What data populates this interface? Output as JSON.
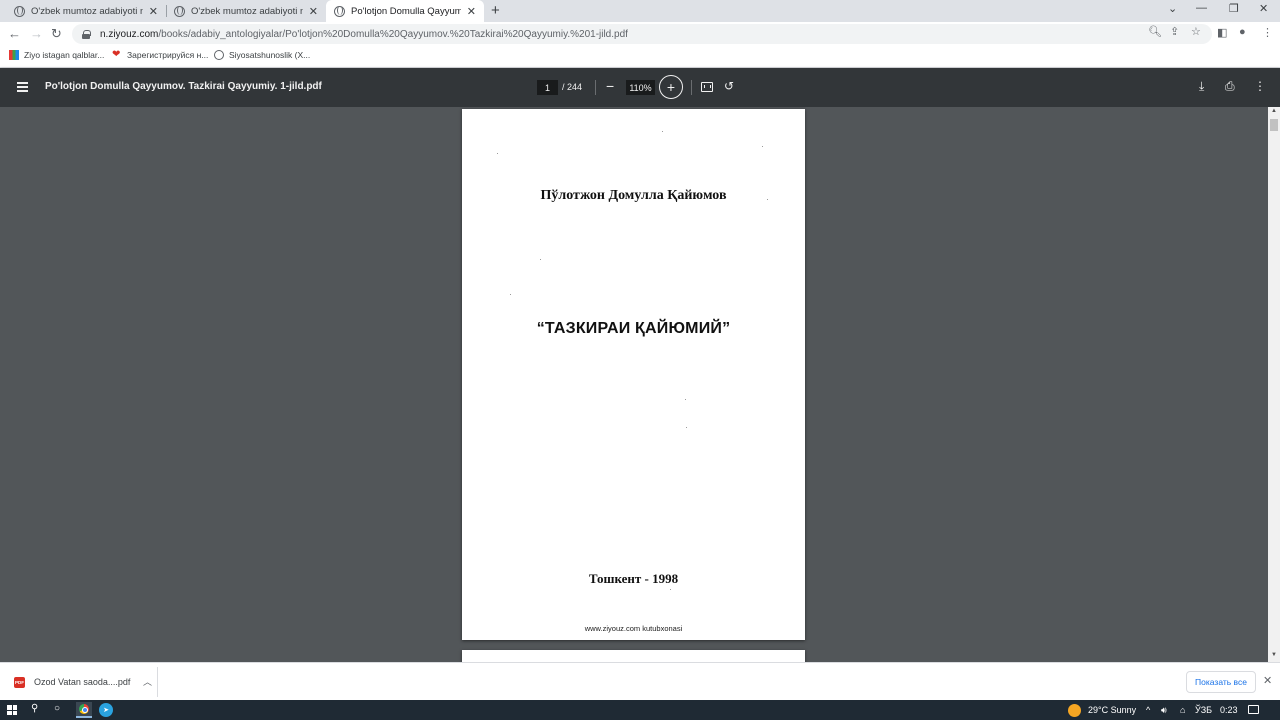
{
  "browser": {
    "tabs": [
      {
        "title": "O'zbek mumtoz adabiyoti namunalari",
        "active": false
      },
      {
        "title": "O'zbek mumtoz adabiyoti namunalari",
        "active": false
      },
      {
        "title": "Po'lotjon Domulla Qayyumov. Tazkirai",
        "active": true
      }
    ],
    "close_glyph": "✕",
    "newtab_glyph": "+",
    "url_host": "n.ziyouz.com",
    "url_path": "/books/adabiy_antologiyalar/Po'lotjon%20Domulla%20Qayyumov.%20Tazkirai%20Qayyumiy.%201-jild.pdf",
    "bookmarks": [
      {
        "label": "Ziyo istagan qalblar...",
        "icon": "ziyo-icon"
      },
      {
        "label": "Зарегистрируйся н...",
        "icon": "heart-icon"
      },
      {
        "label": "Siyosatshunoslik (X...",
        "icon": "globe-icon"
      }
    ]
  },
  "pdf_toolbar": {
    "title": "Po'lotjon Domulla Qayyumov. Tazkirai Qayyumiy. 1-jild.pdf",
    "page_current": "1",
    "page_total": "/ 244",
    "zoom": "110%"
  },
  "pdf_page": {
    "author": "Пўлотжон Домулла Қайюмов",
    "title": "“ТАЗКИРАИ ҚАЙЮМИЙ”",
    "place_year": "Тошкент - 1998",
    "footer": "www.ziyouz.com kutubxonasi"
  },
  "downloads": {
    "file_name": "Ozod Vatan saoda....pdf",
    "file_badge": "PDF",
    "show_all": "Показать все"
  },
  "taskbar": {
    "weather": "29°C  Sunny",
    "language": "ЎЗБ",
    "time": "0:23"
  },
  "colors": {
    "pdf_toolbar_bg": "#323639",
    "viewer_bg": "#525659",
    "accent": "#1a73e8",
    "taskbar_bg": "#1f2a34"
  }
}
